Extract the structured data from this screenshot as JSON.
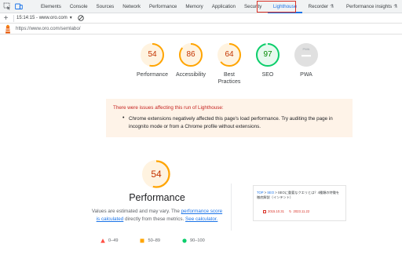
{
  "devtools": {
    "tabs": [
      {
        "label": "Elements"
      },
      {
        "label": "Console"
      },
      {
        "label": "Sources"
      },
      {
        "label": "Network"
      },
      {
        "label": "Performance"
      },
      {
        "label": "Memory"
      },
      {
        "label": "Application"
      },
      {
        "label": "Security"
      },
      {
        "label": "Lighthouse"
      },
      {
        "label": "Recorder"
      },
      {
        "label": "Performance insights"
      }
    ],
    "active_tab": "Lighthouse"
  },
  "toolbar": {
    "report_select": "15:14:15 - www.oro.com"
  },
  "report": {
    "url": "https://www.oro.com/semlabo/",
    "gauges": [
      {
        "label": "Performance",
        "score": "54",
        "color": "#ffa400",
        "ring": "#fff3e0",
        "text_color": "#c33300"
      },
      {
        "label": "Accessibility",
        "score": "86",
        "color": "#ffa400",
        "ring": "#fff3e0",
        "text_color": "#c33300"
      },
      {
        "label": "Best Practices",
        "label_line1": "Best",
        "label_line2": "Practices",
        "score": "64",
        "color": "#ffa400",
        "ring": "#fff3e0",
        "text_color": "#c33300"
      },
      {
        "label": "SEO",
        "score": "97",
        "color": "#0cce6b",
        "ring": "#e6f9ee",
        "text_color": "#008800"
      },
      {
        "label": "PWA",
        "score_text": "PWA"
      }
    ]
  },
  "warning": {
    "title": "There were issues affecting this run of Lighthouse:",
    "message": "Chrome extensions negatively affected this page's load performance. Try auditing the page in incognito mode or from a Chrome profile without extensions."
  },
  "performance": {
    "score": "54",
    "title": "Performance",
    "desc_part1": "Values are estimated and may vary. The ",
    "desc_link1": "performance score is calculated",
    "desc_part2": " directly from these metrics. ",
    "desc_link2": "See calculator."
  },
  "legend": [
    {
      "range": "0–49",
      "color": "#ff4e42",
      "shape": "triangle"
    },
    {
      "range": "50–89",
      "color": "#ffa400",
      "shape": "square"
    },
    {
      "range": "90–100",
      "color": "#0cce6b",
      "shape": "circle"
    }
  ],
  "thumbnail": {
    "breadcrumb_top": "TOP",
    "breadcrumb_sep1": " > ",
    "breadcrumb_mid": "SEO",
    "breadcrumb_sep2": " > ",
    "breadcrumb_title": "SEOに重要なクエリとは？4種類の特徴を徹底解説（インテント）",
    "date1": "2015.10.31",
    "date2": "2023.11.22"
  }
}
